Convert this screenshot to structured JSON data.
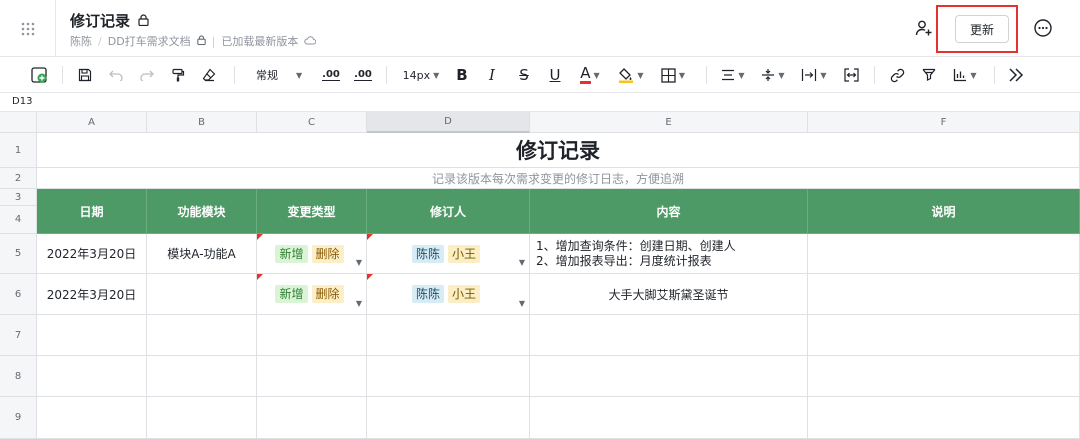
{
  "header": {
    "title": "修订记录",
    "author": "陈陈",
    "folder": "DD打车需求文档",
    "status": "已加载最新版本",
    "update_label": "更新"
  },
  "toolbar": {
    "style_select": "常规",
    "font_size": "14px",
    "decimal_decrease": ".00",
    "decimal_increase": ".00"
  },
  "formula_bar": {
    "cell_ref": "D13"
  },
  "sheet": {
    "columns": [
      "A",
      "B",
      "C",
      "D",
      "E",
      "F"
    ],
    "rows": [
      "1",
      "2",
      "3",
      "4",
      "5",
      "6",
      "7",
      "8",
      "9"
    ],
    "title": "修订记录",
    "subtitle": "记录该版本每次需求变更的修订日志，方便追溯",
    "headers": [
      "日期",
      "功能模块",
      "变更类型",
      "修订人",
      "内容",
      "说明"
    ],
    "records": [
      {
        "date": "2022年3月20日",
        "module": "模块A-功能A",
        "types": [
          "新增",
          "删除"
        ],
        "editors": [
          "陈陈",
          "小王"
        ],
        "content_line1": "1、增加查询条件：创建日期、创建人",
        "content_line2": "2、增加报表导出：月度统计报表",
        "note": ""
      },
      {
        "date": "2022年3月20日",
        "module": "",
        "types": [
          "新增",
          "删除"
        ],
        "editors": [
          "陈陈",
          "小王"
        ],
        "content_line1": "大手大脚艾斯黛圣诞节",
        "content_line2": "",
        "note": ""
      }
    ]
  },
  "colors": {
    "header_green": "#4e9a66",
    "highlight_red": "#e5322d"
  }
}
